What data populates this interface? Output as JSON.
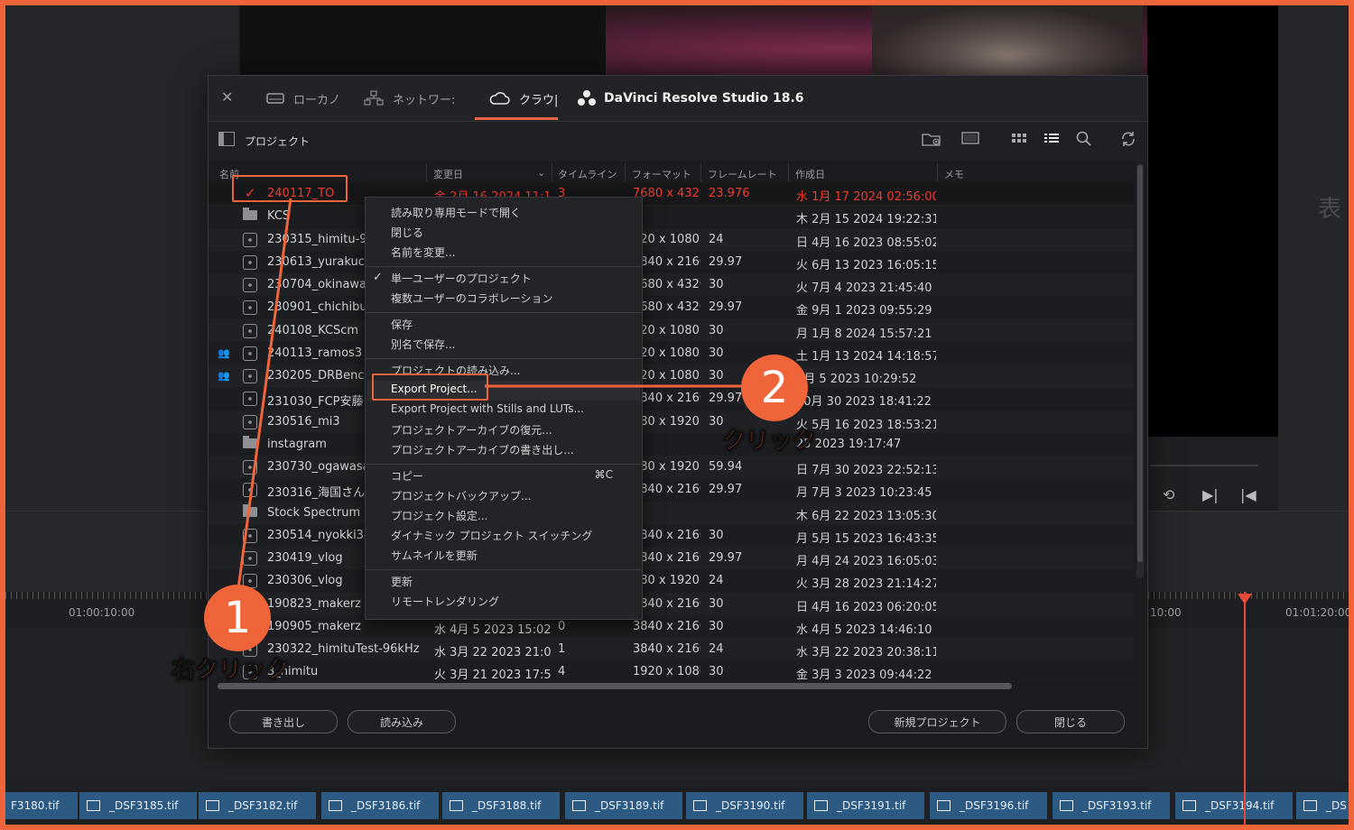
{
  "app": {
    "name": "DaVinci Resolve Studio 18.6"
  },
  "tabs": [
    {
      "label": "ローカノ",
      "icon": "local-drive-icon"
    },
    {
      "label": "ネットワー:",
      "icon": "network-icon"
    },
    {
      "label": "クラウ|",
      "icon": "cloud-icon",
      "active": true
    }
  ],
  "toolbar": {
    "title": "プロジェクト"
  },
  "columns": [
    "名前",
    "変更日",
    "タイムライン",
    "フォーマット",
    "フレームレート",
    "作成日",
    "メモ"
  ],
  "rows": [
    {
      "name": "240117_TO",
      "modified": "金 2月 16 2024 11:1...",
      "timelines": "3",
      "format": "7680 x 4320",
      "fps": "23.976",
      "created": "水 1月 17 2024 02:56:00",
      "selected": true,
      "type": "project"
    },
    {
      "name": "KCS",
      "modified": "",
      "timelines": "",
      "format": "",
      "fps": "",
      "created": "木 2月 15 2024 19:22:31",
      "type": "folder"
    },
    {
      "name": "230315_himitu-9",
      "modified": "",
      "timelines": "",
      "format": "920 x 1080",
      "fps": "24",
      "created": "日 4月 16 2023 08:55:02",
      "type": "project"
    },
    {
      "name": "230613_yurakucl",
      "modified": "",
      "timelines": "",
      "format": "3840 x 2160",
      "fps": "29.97",
      "created": "火 6月 13 2023 16:05:15",
      "type": "project"
    },
    {
      "name": "230704_okinawa",
      "modified": "",
      "timelines": "",
      "format": "7680 x 4320",
      "fps": "30",
      "created": "火 7月 4 2023 21:45:40",
      "type": "project"
    },
    {
      "name": "230901_chichibu",
      "modified": "",
      "timelines": "",
      "format": "7680 x 4320",
      "fps": "29.97",
      "created": "金 9月 1 2023 09:55:29",
      "type": "project"
    },
    {
      "name": "240108_KCScm",
      "modified": "",
      "timelines": "",
      "format": "920 x 1080",
      "fps": "30",
      "created": "月 1月 8 2024 15:57:21",
      "type": "project"
    },
    {
      "name": "240113_ramos3",
      "modified": "",
      "timelines": "",
      "format": "920 x 1080",
      "fps": "30",
      "created": "土 1月 13 2024 14:18:57",
      "type": "project",
      "shared": true
    },
    {
      "name": "230205_DRBench",
      "modified": "",
      "timelines": "",
      "format": "920 x 1080",
      "fps": "30",
      "created": "2月 5 2023 10:29:52",
      "type": "project",
      "shared": true
    },
    {
      "name": "231030_FCP安藤",
      "modified": "",
      "timelines": "",
      "format": "3840 x 2160",
      "fps": "29.97",
      "created": "10月 30 2023 18:41:22",
      "type": "project"
    },
    {
      "name": "230516_mi3",
      "modified": "",
      "timelines": "",
      "format": "080 x 1920",
      "fps": "30",
      "created": "火 5月 16 2023 18:53:21",
      "type": "project"
    },
    {
      "name": "instagram",
      "modified": "",
      "timelines": "",
      "format": "",
      "fps": "",
      "created": "25 2023 19:17:47",
      "type": "folder"
    },
    {
      "name": "230730_ogawasa",
      "modified": "",
      "timelines": "",
      "format": "080 x 1920",
      "fps": "59.94",
      "created": "日 7月 30 2023 22:52:13",
      "type": "project"
    },
    {
      "name": "230316_海国さん",
      "modified": "",
      "timelines": "",
      "format": "3840 x 2160",
      "fps": "29.97",
      "created": "月 7月 3 2023 10:23:45",
      "type": "project"
    },
    {
      "name": "Stock Spectrum",
      "modified": "",
      "timelines": "",
      "format": "",
      "fps": "",
      "created": "木 6月 22 2023 13:05:30",
      "type": "folder"
    },
    {
      "name": "230514_nyokki3",
      "modified": "",
      "timelines": "",
      "format": "3840 x 2160",
      "fps": "30",
      "created": "月 5月 15 2023 16:43:35",
      "type": "project"
    },
    {
      "name": "230419_vlog",
      "modified": "",
      "timelines": "",
      "format": "3840 x 2160",
      "fps": "29.97",
      "created": "月 4月 24 2023 16:05:03",
      "type": "project"
    },
    {
      "name": "230306_vlog",
      "modified": "",
      "timelines": "",
      "format": "080 x 1920",
      "fps": "24",
      "created": "火 3月 28 2023 21:14:27",
      "type": "project"
    },
    {
      "name": "190823_makerz",
      "modified": "",
      "timelines": "",
      "format": "3840 x 2160",
      "fps": "30",
      "created": "日 4月 16 2023 06:20:05",
      "type": "project"
    },
    {
      "name": "190905_makerz",
      "modified": "水 4月 5 2023 15:02:...",
      "timelines": "0",
      "format": "3840 x 2160",
      "fps": "30",
      "created": "水 4月 5 2023 14:46:10",
      "type": "project"
    },
    {
      "name": "230322_himituTest-96kHz",
      "modified": "水 3月 22 2023 21:0...",
      "timelines": "1",
      "format": "3840 x 2160",
      "fps": "24",
      "created": "水 3月 22 2023 20:38:11",
      "type": "project"
    },
    {
      "name": "3_himitu",
      "modified": "火 3月 21 2023 17:5...",
      "timelines": "4",
      "format": "1920 x 1080",
      "fps": "30",
      "created": "金 3月 3 2023 09:44:22",
      "type": "project"
    }
  ],
  "context_menu": {
    "groups": [
      [
        "読み取り専用モードで開く",
        "閉じる",
        "名前を変更..."
      ],
      [
        "単一ユーザーのプロジェクト",
        "複数ユーザーのコラボレーション"
      ],
      [
        "保存",
        "別名で保存..."
      ],
      [
        "プロジェクトの読み込み...",
        "Export Project...",
        "Export Project with Stills and LUTs...",
        "プロジェクトアーカイブの復元...",
        "プロジェクトアーカイブの書き出し..."
      ],
      [
        "コピー",
        "プロジェクトバックアップ...",
        "プロジェクト設定...",
        "ダイナミック プロジェクト スイッチング",
        "サムネイルを更新"
      ],
      [
        "更新",
        "リモートレンダリング"
      ]
    ],
    "checked": "単一ユーザーのプロジェクト",
    "highlighted": "Export Project...",
    "copy_shortcut": "⌘C"
  },
  "buttons": {
    "export": "書き出し",
    "import": "読み込み",
    "new_project": "新規プロジェクト",
    "close": "閉じる"
  },
  "annotations": {
    "step1_number": "1",
    "step1_label": "右クリック",
    "step2_number": "2",
    "step2_label": "クリック",
    "accent": "#f0643a"
  },
  "timeline": {
    "timecode_left": "01:00:10:00",
    "timecode_mid": "10:00",
    "timecode_right": "01:01:20:00",
    "clips": [
      "F3180.tif",
      "_DSF3185.tif",
      "_DSF3182.tif",
      "_DSF3186.tif",
      "_DSF3188.tif",
      "_DSF3189.tif",
      "_DSF3190.tif",
      "_DSF3191.tif",
      "_DSF3196.tif",
      "_DSF3193.tif",
      "_DSF3194.tif",
      "_DS"
    ]
  },
  "side_glyph": "表"
}
